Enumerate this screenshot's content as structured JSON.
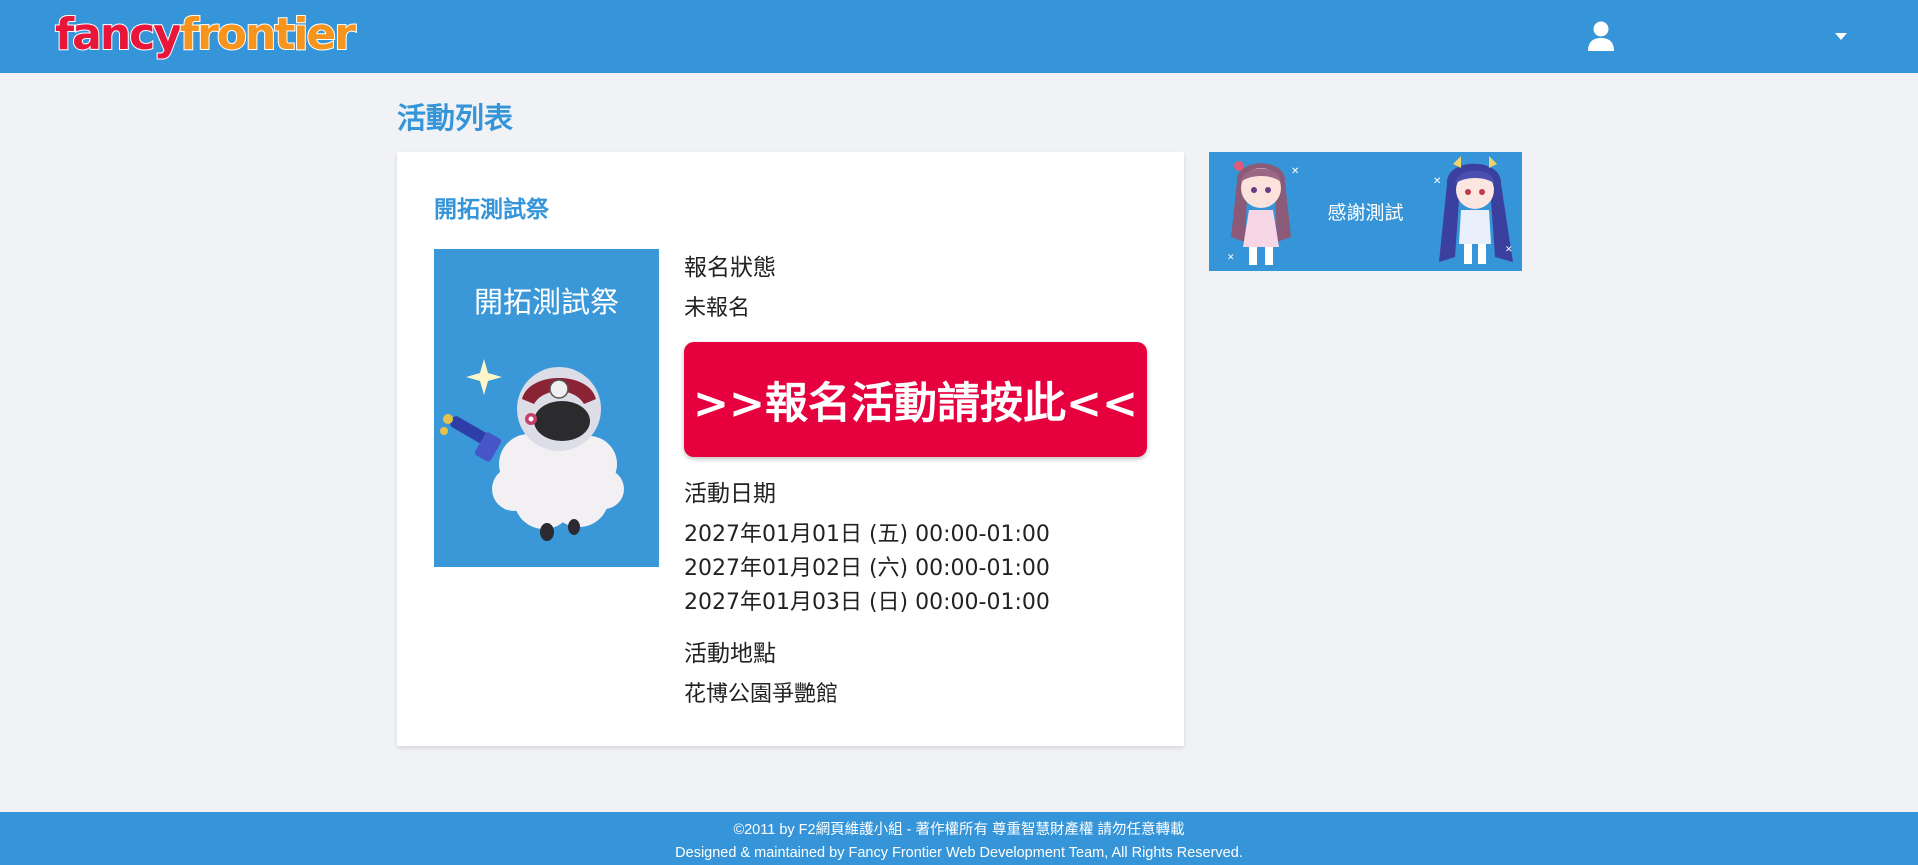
{
  "header": {
    "logo_part1": "fancy",
    "logo_part2": "frontier",
    "user_icon": "user-icon",
    "dropdown_icon": "caret-down-icon"
  },
  "page": {
    "title": "活動列表"
  },
  "event": {
    "title": "開拓測試祭",
    "poster_title": "開拓測試祭",
    "status_label": "報名狀態",
    "status_value": "未報名",
    "signup_button": ">>報名活動請按此<<",
    "date_label": "活動日期",
    "dates": [
      "2027年01月01日 (五) 00:00-01:00",
      "2027年01月02日 (六) 00:00-01:00",
      "2027年01月03日 (日) 00:00-01:00"
    ],
    "location_label": "活動地點",
    "location_value": "花博公園爭艷館"
  },
  "banner": {
    "text": "感謝測試"
  },
  "footer": {
    "line1": "©2011 by F2網頁維護小組 - 著作權所有 尊重智慧財產權 請勿任意轉載",
    "line2": "Designed & maintained by Fancy Frontier Web Development Team, All Rights Reserved."
  },
  "colors": {
    "brand_blue": "#3595d8",
    "signup_red": "#e6003e",
    "page_bg": "#f1f2f6"
  }
}
